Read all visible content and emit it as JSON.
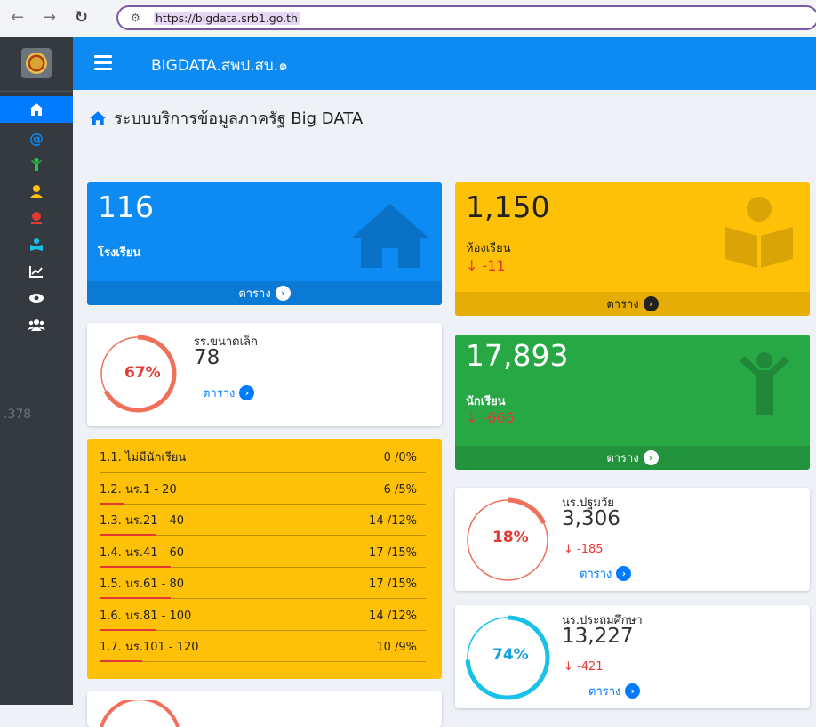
{
  "browser": {
    "url": "https://bigdata.srb1.go.th"
  },
  "sidebar": {
    "counter": ".378"
  },
  "topbar": {
    "brand": "BIGDATA.สพป.สบ.๑"
  },
  "page": {
    "title": "ระบบบริการข้อมูลภาครัฐ Big DATA"
  },
  "boxes": {
    "schools": {
      "value": "116",
      "label": "โรงเรียน",
      "link": "ตาราง"
    },
    "classrooms": {
      "value": "1,150",
      "label": "ห้องเรียน",
      "change": "-11",
      "link": "ตาราง"
    },
    "students": {
      "value": "17,893",
      "label": "นักเรียน",
      "change": "-666",
      "link": "ตาราง"
    }
  },
  "small_schools": {
    "label": "รร.ขนาดเล็ก",
    "value": "78",
    "percent": "67%",
    "percent_value": 67,
    "link": "ตาราง"
  },
  "preschool": {
    "label": "นร.ปฐมวัย",
    "value": "3,306",
    "percent": "18%",
    "percent_value": 18,
    "change": "-185",
    "link": "ตาราง"
  },
  "primary": {
    "label": "นร.ประถมศึกษา",
    "value": "13,227",
    "percent": "74%",
    "percent_value": 74,
    "change": "-421",
    "link": "ตาราง"
  },
  "size_list": [
    {
      "label": "1.1. ไม่มีนักเรียน",
      "value": "0 /0%",
      "pct": 0
    },
    {
      "label": "1.2. นร.1 - 20",
      "value": "6 /5%",
      "pct": 5
    },
    {
      "label": "1.3. นร.21 - 40",
      "value": "14 /12%",
      "pct": 12
    },
    {
      "label": "1.4. นร.41 - 60",
      "value": "17 /15%",
      "pct": 15
    },
    {
      "label": "1.5. นร.61 - 80",
      "value": "17 /15%",
      "pct": 15
    },
    {
      "label": "1.6. นร.81 - 100",
      "value": "14 /12%",
      "pct": 12
    },
    {
      "label": "1.7. นร.101 - 120",
      "value": "10 /9%",
      "pct": 9
    }
  ],
  "colors": {
    "primary": "#007bff",
    "warning": "#ffc107",
    "success": "#28a745",
    "danger": "#e53935",
    "sidebar": "#343a40",
    "gauge_red": "#f0705a",
    "gauge_cyan": "#17c1e8"
  },
  "icons": [
    "home-icon",
    "at-icon",
    "child-icon",
    "teacher-icon",
    "money-icon",
    "reading-icon",
    "chart-line-icon",
    "eye-icon",
    "users-icon"
  ]
}
